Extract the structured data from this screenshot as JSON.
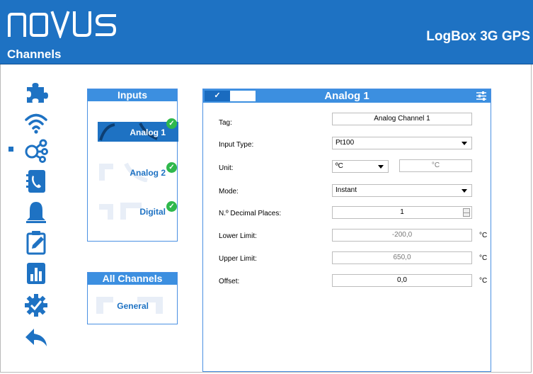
{
  "header": {
    "logo_text": "NOVUS",
    "page_title": "Channels",
    "product_name": "LogBox 3G GPS"
  },
  "nav": {
    "items": [
      {
        "icon": "puzzle-icon"
      },
      {
        "icon": "wifi-icon"
      },
      {
        "icon": "channels-icon"
      },
      {
        "icon": "contact-book-icon"
      },
      {
        "icon": "bell-icon"
      },
      {
        "icon": "clipboard-edit-icon"
      },
      {
        "icon": "bar-chart-icon"
      },
      {
        "icon": "gear-icon"
      },
      {
        "icon": "back-arrow-icon"
      }
    ]
  },
  "inputs_panel": {
    "title": "Inputs",
    "channels": [
      {
        "label": "Analog 1",
        "enabled": true,
        "selected": true
      },
      {
        "label": "Analog 2",
        "enabled": true,
        "selected": false
      },
      {
        "label": "Digital",
        "enabled": true,
        "selected": false
      }
    ]
  },
  "all_channels_panel": {
    "title": "All Channels",
    "items": [
      {
        "label": "General"
      }
    ]
  },
  "channel_form": {
    "title": "Analog 1",
    "enable_label": "✓",
    "tag": {
      "label": "Tag:",
      "value": "Analog Channel 1"
    },
    "input_type": {
      "label": "Input Type:",
      "value": "Pt100"
    },
    "unit": {
      "label": "Unit:",
      "value": "ºC",
      "custom": "°C"
    },
    "mode": {
      "label": "Mode:",
      "value": "Instant"
    },
    "decimal_places": {
      "label": "N.º Decimal Places:",
      "value": "1"
    },
    "lower_limit": {
      "label": "Lower Limit:",
      "value": "-200,0",
      "unit": "°C"
    },
    "upper_limit": {
      "label": "Upper Limit:",
      "value": "650,0",
      "unit": "°C"
    },
    "offset": {
      "label": "Offset:",
      "value": "0,0",
      "unit": "°C"
    }
  },
  "colors": {
    "brand_blue": "#1e72c3",
    "header_blue": "#3c8fe0",
    "ok_green": "#2fb84c"
  }
}
